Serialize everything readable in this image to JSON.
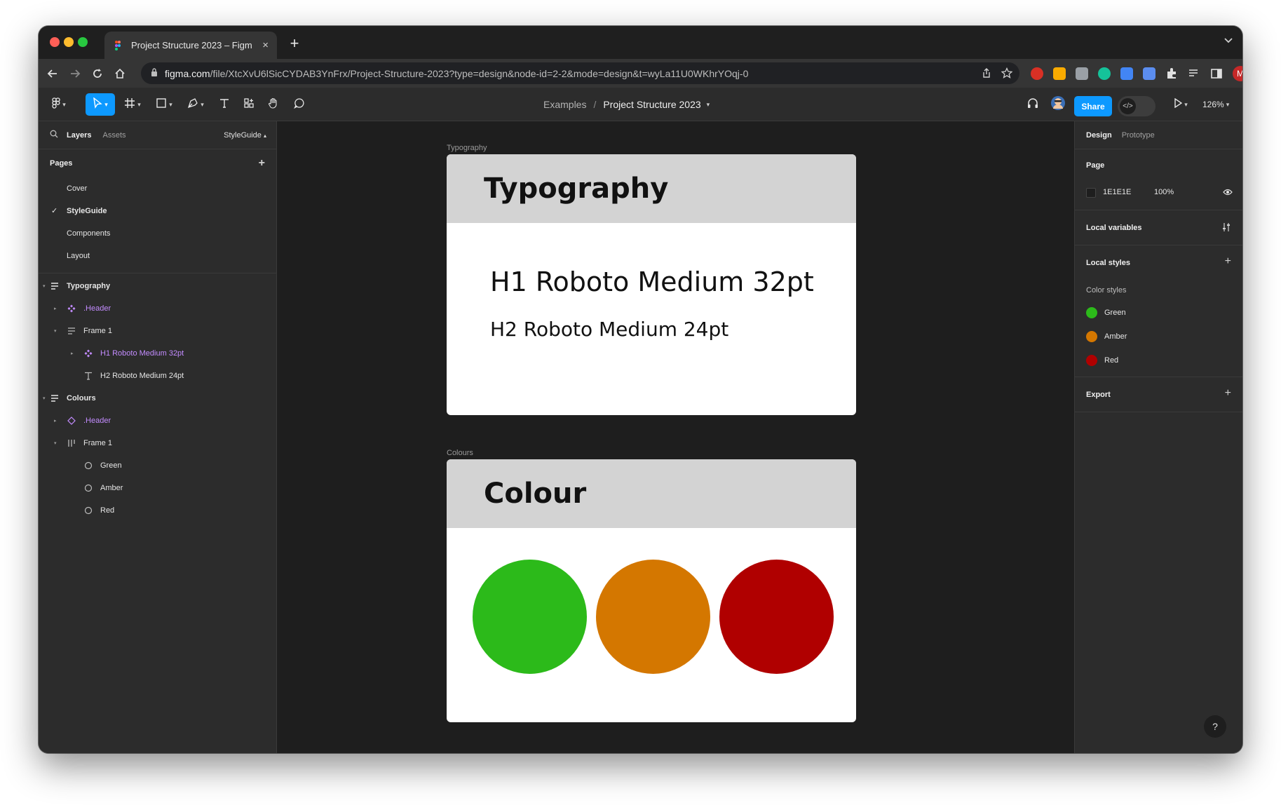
{
  "colors": {
    "green": "#2cba1a",
    "amber": "#d47700",
    "red": "#b00000",
    "accent": "#0d99ff",
    "component": "#c38cff"
  },
  "browser": {
    "tab_title": "Project Structure 2023 – Figm",
    "tab_close": "×",
    "new_tab": "+",
    "url_host": "figma.com",
    "url_path": "/file/XtcXvU6lSicCYDAB3YnFrx/Project-Structure-2023?type=design&node-id=2-2&mode=design&t=wyLa11U0WKhrYOqj-0",
    "profile_initial": "M"
  },
  "toolbar": {
    "breadcrumb_parent": "Examples",
    "breadcrumb_sep": "/",
    "file_name": "Project Structure 2023",
    "share_label": "Share",
    "dev_label": "</>",
    "zoom_label": "126%"
  },
  "left_panel": {
    "tabs": [
      "Layers",
      "Assets"
    ],
    "current_page_label": "StyleGuide",
    "pages_heading": "Pages",
    "pages": [
      {
        "label": "Cover"
      },
      {
        "label": "StyleGuide"
      },
      {
        "label": "Components"
      },
      {
        "label": "Layout"
      }
    ],
    "layers": [
      {
        "label": "Typography"
      },
      {
        "label": ".Header"
      },
      {
        "label": "Frame 1"
      },
      {
        "label": "H1 Roboto Medium 32pt"
      },
      {
        "label": "H2 Roboto Medium 24pt"
      },
      {
        "label": "Colours"
      },
      {
        "label": ".Header"
      },
      {
        "label": "Frame 1"
      },
      {
        "label": "Green"
      },
      {
        "label": "Amber"
      },
      {
        "label": "Red"
      }
    ]
  },
  "canvas": {
    "typography_frame": {
      "label": "Typography",
      "header": "Typography",
      "h1_sample": "H1 Roboto Medium 32pt",
      "h2_sample": "H2 Roboto Medium 24pt"
    },
    "colours_frame": {
      "label": "Colours",
      "header": "Colour"
    }
  },
  "right_panel": {
    "tabs": [
      "Design",
      "Prototype"
    ],
    "page_heading": "Page",
    "page_fill_hex": "1E1E1E",
    "page_fill_opacity": "100%",
    "local_variables": "Local variables",
    "local_styles": "Local styles",
    "color_styles_heading": "Color styles",
    "color_styles": [
      {
        "label": "Green"
      },
      {
        "label": "Amber"
      },
      {
        "label": "Red"
      }
    ],
    "export_heading": "Export"
  },
  "help_label": "?"
}
